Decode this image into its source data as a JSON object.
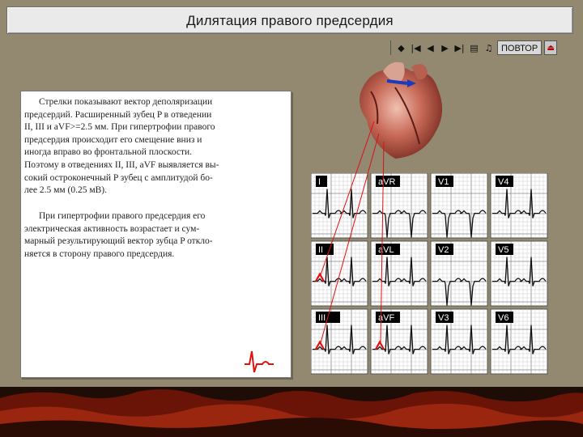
{
  "window": {
    "title": "Дилятация правого предсердия"
  },
  "toolbar": {
    "items": [
      "help-icon",
      "first-icon",
      "prev-icon",
      "next-icon",
      "last-icon",
      "contents-icon",
      "sound-icon"
    ],
    "repeat_label": "ПОВТОР",
    "exit_icon": "exit-icon"
  },
  "text_panel": {
    "paragraph1_lines": [
      "Стрелки показывают вектор деполяризации",
      "предсердий. Расширенный зубец P в отведении",
      "II, III и aVF>=2.5 мм. При гипертрофии правого",
      "предсердия происходит его смещение вниз и",
      "иногда вправо во фронтальной плоскости.",
      "Поэтому в отведениях II, III, aVF выявляется вы-",
      "сокий остроконечный P зубец с амплитудой бо-",
      "лее 2.5 мм (0.25 мВ)."
    ],
    "paragraph2_lines": [
      "При гипертрофии правого предсердия его",
      "электрическая активность возрастает и сум-",
      "марный результирующий вектор зубца P откло-",
      "няется в сторону правого предсердия."
    ]
  },
  "ecg": {
    "leads": [
      "I",
      "aVR",
      "V1",
      "V4",
      "II",
      "aVL",
      "V2",
      "V5",
      "III",
      "aVF",
      "V3",
      "V6"
    ],
    "highlighted_leads": [
      "II",
      "III",
      "aVF"
    ],
    "highlight_color": "#e01010"
  },
  "colors": {
    "background": "#928970",
    "footer_dark": "#1e0d06",
    "footer_red": "#8a1a0c"
  }
}
